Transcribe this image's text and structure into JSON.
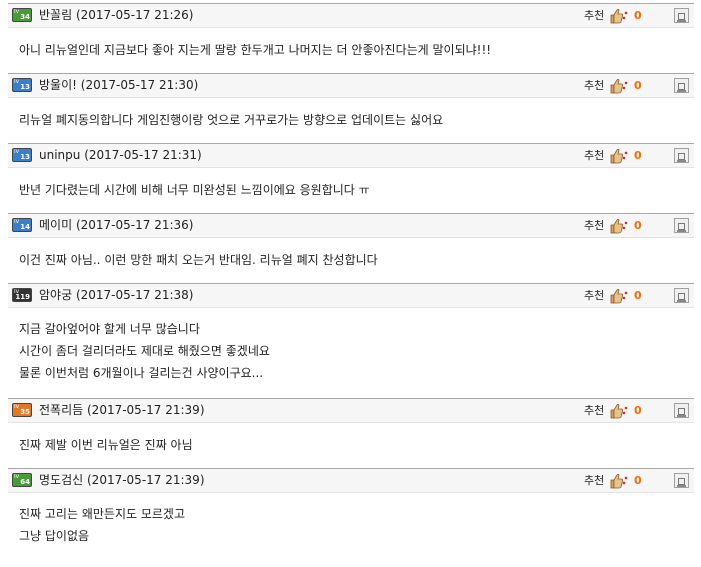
{
  "recommend_label": "추천",
  "comments": [
    {
      "author": "반꼴림",
      "timestamp": "(2017-05-17 21:26)",
      "level": "34",
      "badge_color": "#4a9a3a",
      "votes": "0",
      "lines": [
        "아니 리뉴얼인데 지금보다 좋아 지는게 딸랑 한두개고 나머지는 더 안좋아진다는게 말이되냐!!!"
      ]
    },
    {
      "author": "방울이!",
      "timestamp": "(2017-05-17 21:30)",
      "level": "13",
      "badge_color": "#3a7fc8",
      "votes": "0",
      "lines": [
        "리뉴얼 폐지동의합니다 게임진행이랑 엇으로 거꾸로가는 방향으로 업데이트는 싫어요"
      ]
    },
    {
      "author": "uninpu",
      "timestamp": "(2017-05-17 21:31)",
      "level": "13",
      "badge_color": "#3a7fc8",
      "votes": "0",
      "lines": [
        "반년 기다렸는데 시간에 비해 너무 미완성된 느낌이에요 응원합니다 ㅠ"
      ]
    },
    {
      "author": "메이미",
      "timestamp": "(2017-05-17 21:36)",
      "level": "14",
      "badge_color": "#3a7fc8",
      "votes": "0",
      "lines": [
        "이건 진짜 아님.. 이런 망한 패치 오는거 반대임. 리뉴얼 폐지 찬성합니다"
      ]
    },
    {
      "author": "암야궁",
      "timestamp": "(2017-05-17 21:38)",
      "level": "119",
      "badge_color": "#333333",
      "votes": "0",
      "lines": [
        "지금 갈아엎어야 할게 너무 많습니다",
        "시간이 좀더 걸리더라도 제대로 해줬으면 좋겠네요",
        "물론 이번처럼 6개월이나 걸리는건 사양이구요..."
      ]
    },
    {
      "author": "전폭리듬",
      "timestamp": "(2017-05-17 21:39)",
      "level": "35",
      "badge_color": "#e07a2a",
      "votes": "0",
      "lines": [
        "진짜 제발 이번 리뉴얼은 진짜 아님"
      ]
    },
    {
      "author": "명도검신",
      "timestamp": "(2017-05-17 21:39)",
      "level": "64",
      "badge_color": "#4a9a3a",
      "votes": "0",
      "lines": [
        "진짜 고리는 왜만든지도 모르겠고",
        "그냥 답이없음"
      ]
    }
  ]
}
